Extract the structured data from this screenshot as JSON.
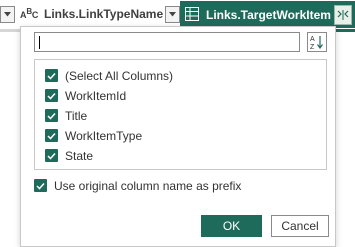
{
  "header": {
    "type_icon_text": "A",
    "type_icon_sub": "B",
    "type_icon_tail": "C",
    "column1_name": "Links.LinkTypeName",
    "column2_name": "Links.TargetWorkItem",
    "column2_icon": "table-icon",
    "expand_icon": "expand-columns-icon",
    "accent_color": "#1f6b5b"
  },
  "expand_panel": {
    "search": {
      "value": "",
      "placeholder": ""
    },
    "sort_icon": "sort-az-icon",
    "columns": [
      {
        "label": "(Select All Columns)",
        "checked": true
      },
      {
        "label": "WorkItemId",
        "checked": true
      },
      {
        "label": "Title",
        "checked": true
      },
      {
        "label": "WorkItemType",
        "checked": true
      },
      {
        "label": "State",
        "checked": true
      }
    ],
    "prefix_option": {
      "label": "Use original column name as prefix",
      "checked": true
    },
    "ok_label": "OK",
    "cancel_label": "Cancel"
  }
}
